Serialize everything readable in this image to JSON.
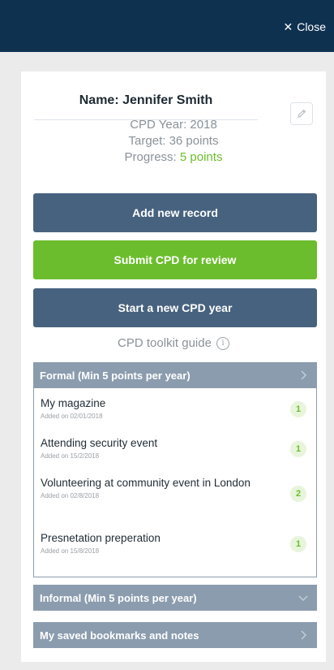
{
  "header": {
    "close_label": "Close"
  },
  "profile": {
    "name_label": "Name: Jennifer Smith",
    "cpd_year": "CPD Year: 2018",
    "target": "Target: 36 points",
    "progress_label": "Progress:",
    "progress_value": "5 points"
  },
  "actions": {
    "add_record": "Add new record",
    "submit_review": "Submit CPD for review",
    "start_year": "Start a new CPD year"
  },
  "toolkit": {
    "label": "CPD toolkit guide"
  },
  "sections": {
    "formal": {
      "title": "Formal (Min 5 points per year)",
      "items": [
        {
          "title": "My magazine",
          "date": "Added on 02/01/2018",
          "points": "1"
        },
        {
          "title": "Attending security event",
          "date": "Added on 15/2/2018",
          "points": "1"
        },
        {
          "title": "Volunteering at community event in London",
          "date": "Added on 02/8/2018",
          "points": "2"
        },
        {
          "title": "Presnetation preperation",
          "date": "Added on 15/8/2018",
          "points": "1"
        }
      ]
    },
    "informal": {
      "title": "Informal (Min 5 points per year)"
    },
    "bookmarks": {
      "title": "My saved bookmarks and notes"
    }
  },
  "colors": {
    "topbar": "#0f3150",
    "navy_button": "#47627f",
    "green_button": "#6cbd2d",
    "section_header": "#8b9cae",
    "progress_text": "#6cbd2d"
  }
}
